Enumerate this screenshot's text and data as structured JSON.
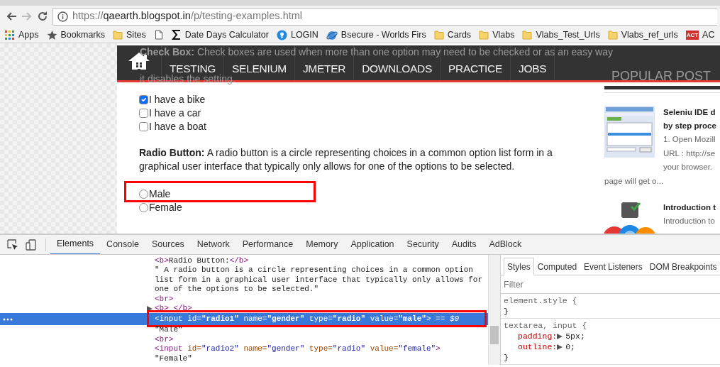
{
  "browser": {
    "url_parts": [
      {
        "text": "https://",
        "strong": false
      },
      {
        "text": "qaearth.blogspot.in",
        "strong": true
      },
      {
        "text": "/p/testing-examples.html",
        "strong": false
      }
    ],
    "bookmarks": [
      {
        "kind": "apps",
        "label": "Apps"
      },
      {
        "kind": "star",
        "label": "Bookmarks"
      },
      {
        "kind": "folder",
        "label": "Sites"
      },
      {
        "kind": "page"
      },
      {
        "kind": "sigma",
        "label": "Date Days Calculator"
      },
      {
        "kind": "dot",
        "label": "LOGIN"
      },
      {
        "kind": "globe",
        "label": "Bsecure - Worlds Firs"
      },
      {
        "kind": "folder",
        "label": "Cards"
      },
      {
        "kind": "folder",
        "label": "Vlabs"
      },
      {
        "kind": "folder",
        "label": "Vlabs_Test_Urls"
      },
      {
        "kind": "folder",
        "label": "Vlabs_ref_urls"
      },
      {
        "kind": "logo",
        "logo_text": "ACT",
        "label": "AC"
      }
    ]
  },
  "page": {
    "nav": [
      "TESTING",
      "SELENIUM",
      "JMETER",
      "DOWNLOADS",
      "PRACTICE",
      "JOBS"
    ],
    "behind_nav": [
      "**Check Box:** Check boxes are used when more than one option may need to be checked or as an easy way",
      "it disables the setting."
    ],
    "sidebar_title": "POPULAR POST",
    "checkboxes": [
      {
        "label": "I have a bike",
        "checked": true
      },
      {
        "label": "I have a car",
        "checked": false
      },
      {
        "label": "I have a boat",
        "checked": false
      }
    ],
    "radio_text": "**Radio Button:** A radio button is a circle representing choices in a common option list form in a graphical user interface that typically only allows for one of the options to be selected.",
    "radios": [
      {
        "label": "Male",
        "selected": false,
        "annotated": true
      },
      {
        "label": "Female",
        "selected": false,
        "annotated": false
      }
    ],
    "posts": [
      {
        "kind": "picture",
        "title": [
          "Seleniu IDE d",
          "by step proce"
        ],
        "excerpt": [
          "1. Open Mozill",
          "URL : http://se",
          "your browser."
        ],
        "excerpt_tail": "page will get o..."
      },
      {
        "kind": "picture",
        "title": [
          "Introduction t"
        ],
        "excerpt": [
          "Introduction to"
        ]
      }
    ]
  },
  "devtools": {
    "tabs": [
      {
        "label": "Elements",
        "selected": true
      },
      {
        "label": "Console",
        "selected": false
      },
      {
        "label": "Sources",
        "selected": false
      },
      {
        "label": "Network",
        "selected": false
      },
      {
        "label": "Performance",
        "selected": false
      },
      {
        "label": "Memory",
        "selected": false
      },
      {
        "label": "Application",
        "selected": false
      },
      {
        "label": "Security",
        "selected": false
      },
      {
        "label": "Audits",
        "selected": false
      },
      {
        "label": "AdBlock",
        "selected": false
      }
    ],
    "code": [
      {
        "selected": false,
        "annotated": false,
        "expander": false,
        "tokens": [
          {
            "kind": "tag",
            "text": "<b>"
          },
          {
            "kind": "text",
            "text": "Radio Button:"
          },
          {
            "kind": "tag",
            "text": "</b>"
          }
        ]
      },
      {
        "selected": false,
        "annotated": false,
        "expander": false,
        "tokens": [
          {
            "kind": "text",
            "text": "\" A radio button is a circle representing choices in a common option"
          }
        ]
      },
      {
        "selected": false,
        "annotated": false,
        "expander": false,
        "tokens": [
          {
            "kind": "text",
            "text": "list form in a graphical user interface that typically only allows for"
          }
        ]
      },
      {
        "selected": false,
        "annotated": false,
        "expander": false,
        "tokens": [
          {
            "kind": "text",
            "text": "one of the options to be selected.\""
          }
        ]
      },
      {
        "selected": false,
        "annotated": false,
        "expander": false,
        "tokens": [
          {
            "kind": "tag",
            "text": "<br>"
          }
        ]
      },
      {
        "selected": false,
        "annotated": false,
        "expander": true,
        "tokens": [
          {
            "kind": "tag",
            "text": "<b> </b>"
          }
        ]
      },
      {
        "selected": true,
        "annotated": true,
        "expander": false,
        "tokens": [
          {
            "kind": "tag",
            "text": "<input"
          },
          {
            "kind": "attr",
            "text": " id="
          },
          {
            "kind": "value",
            "text": "\"radio1\""
          },
          {
            "kind": "attr",
            "text": " name="
          },
          {
            "kind": "value",
            "text": "\"gender\""
          },
          {
            "kind": "attr",
            "text": " type="
          },
          {
            "kind": "value",
            "text": "\"radio\""
          },
          {
            "kind": "attr",
            "text": " value="
          },
          {
            "kind": "value",
            "text": "\"male\""
          },
          {
            "kind": "tag",
            "text": ">"
          },
          {
            "kind": "var",
            "text": " == $0"
          }
        ]
      },
      {
        "selected": false,
        "annotated": false,
        "expander": false,
        "tokens": [
          {
            "kind": "text",
            "text": "\"Male\""
          }
        ]
      },
      {
        "selected": false,
        "annotated": false,
        "expander": false,
        "tokens": [
          {
            "kind": "tag",
            "text": "<br>"
          }
        ]
      },
      {
        "selected": false,
        "annotated": false,
        "expander": false,
        "tokens": [
          {
            "kind": "tag",
            "text": "<input"
          },
          {
            "kind": "attr",
            "text": " id="
          },
          {
            "kind": "value",
            "text": "\"radio2\""
          },
          {
            "kind": "attr",
            "text": " name="
          },
          {
            "kind": "value",
            "text": "\"gender\""
          },
          {
            "kind": "attr",
            "text": " type="
          },
          {
            "kind": "value",
            "text": "\"radio\""
          },
          {
            "kind": "attr",
            "text": " value="
          },
          {
            "kind": "value",
            "text": "\"female\""
          },
          {
            "kind": "tag",
            "text": ">"
          }
        ]
      },
      {
        "selected": false,
        "annotated": false,
        "expander": false,
        "tokens": [
          {
            "kind": "text",
            "text": "\"Female\""
          }
        ]
      }
    ],
    "side_tabs": [
      {
        "label": "Styles",
        "selected": true
      },
      {
        "label": "Computed",
        "selected": false
      },
      {
        "label": "Event Listeners",
        "selected": false
      },
      {
        "label": "DOM Breakpoints",
        "selected": false
      }
    ],
    "filter": {
      "placeholder": "Filter"
    },
    "rules": [
      {
        "selector": "element.style {",
        "close": "}"
      },
      {
        "selector": "textarea, input {",
        "close": "}",
        "props": [
          {
            "name": "padding:",
            "value": "5px;"
          },
          {
            "name": "outline:",
            "value": "0;"
          }
        ]
      }
    ]
  }
}
